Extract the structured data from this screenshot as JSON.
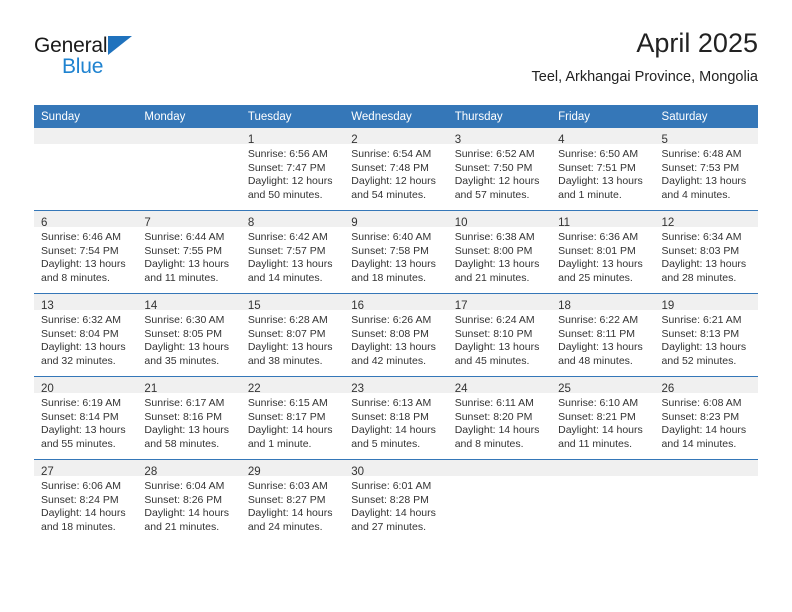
{
  "logo": {
    "primary_text": "General",
    "secondary_text": "Blue",
    "triangle_icon": "triangle-icon",
    "primary_color": "#1a1a1a",
    "secondary_color": "#1f83d0"
  },
  "header": {
    "title": "April 2025",
    "subtitle": "Teel, Arkhangai Province, Mongolia"
  },
  "colors": {
    "header_blue": "#3577b8",
    "daynum_band": "#f0f0f0",
    "text": "#333333"
  },
  "calendar": {
    "columns": [
      "Sunday",
      "Monday",
      "Tuesday",
      "Wednesday",
      "Thursday",
      "Friday",
      "Saturday"
    ],
    "weeks": [
      [
        {
          "day": "",
          "lines": []
        },
        {
          "day": "",
          "lines": []
        },
        {
          "day": "1",
          "lines": [
            "Sunrise: 6:56 AM",
            "Sunset: 7:47 PM",
            "Daylight: 12 hours",
            "and 50 minutes."
          ]
        },
        {
          "day": "2",
          "lines": [
            "Sunrise: 6:54 AM",
            "Sunset: 7:48 PM",
            "Daylight: 12 hours",
            "and 54 minutes."
          ]
        },
        {
          "day": "3",
          "lines": [
            "Sunrise: 6:52 AM",
            "Sunset: 7:50 PM",
            "Daylight: 12 hours",
            "and 57 minutes."
          ]
        },
        {
          "day": "4",
          "lines": [
            "Sunrise: 6:50 AM",
            "Sunset: 7:51 PM",
            "Daylight: 13 hours",
            "and 1 minute."
          ]
        },
        {
          "day": "5",
          "lines": [
            "Sunrise: 6:48 AM",
            "Sunset: 7:53 PM",
            "Daylight: 13 hours",
            "and 4 minutes."
          ]
        }
      ],
      [
        {
          "day": "6",
          "lines": [
            "Sunrise: 6:46 AM",
            "Sunset: 7:54 PM",
            "Daylight: 13 hours",
            "and 8 minutes."
          ]
        },
        {
          "day": "7",
          "lines": [
            "Sunrise: 6:44 AM",
            "Sunset: 7:55 PM",
            "Daylight: 13 hours",
            "and 11 minutes."
          ]
        },
        {
          "day": "8",
          "lines": [
            "Sunrise: 6:42 AM",
            "Sunset: 7:57 PM",
            "Daylight: 13 hours",
            "and 14 minutes."
          ]
        },
        {
          "day": "9",
          "lines": [
            "Sunrise: 6:40 AM",
            "Sunset: 7:58 PM",
            "Daylight: 13 hours",
            "and 18 minutes."
          ]
        },
        {
          "day": "10",
          "lines": [
            "Sunrise: 6:38 AM",
            "Sunset: 8:00 PM",
            "Daylight: 13 hours",
            "and 21 minutes."
          ]
        },
        {
          "day": "11",
          "lines": [
            "Sunrise: 6:36 AM",
            "Sunset: 8:01 PM",
            "Daylight: 13 hours",
            "and 25 minutes."
          ]
        },
        {
          "day": "12",
          "lines": [
            "Sunrise: 6:34 AM",
            "Sunset: 8:03 PM",
            "Daylight: 13 hours",
            "and 28 minutes."
          ]
        }
      ],
      [
        {
          "day": "13",
          "lines": [
            "Sunrise: 6:32 AM",
            "Sunset: 8:04 PM",
            "Daylight: 13 hours",
            "and 32 minutes."
          ]
        },
        {
          "day": "14",
          "lines": [
            "Sunrise: 6:30 AM",
            "Sunset: 8:05 PM",
            "Daylight: 13 hours",
            "and 35 minutes."
          ]
        },
        {
          "day": "15",
          "lines": [
            "Sunrise: 6:28 AM",
            "Sunset: 8:07 PM",
            "Daylight: 13 hours",
            "and 38 minutes."
          ]
        },
        {
          "day": "16",
          "lines": [
            "Sunrise: 6:26 AM",
            "Sunset: 8:08 PM",
            "Daylight: 13 hours",
            "and 42 minutes."
          ]
        },
        {
          "day": "17",
          "lines": [
            "Sunrise: 6:24 AM",
            "Sunset: 8:10 PM",
            "Daylight: 13 hours",
            "and 45 minutes."
          ]
        },
        {
          "day": "18",
          "lines": [
            "Sunrise: 6:22 AM",
            "Sunset: 8:11 PM",
            "Daylight: 13 hours",
            "and 48 minutes."
          ]
        },
        {
          "day": "19",
          "lines": [
            "Sunrise: 6:21 AM",
            "Sunset: 8:13 PM",
            "Daylight: 13 hours",
            "and 52 minutes."
          ]
        }
      ],
      [
        {
          "day": "20",
          "lines": [
            "Sunrise: 6:19 AM",
            "Sunset: 8:14 PM",
            "Daylight: 13 hours",
            "and 55 minutes."
          ]
        },
        {
          "day": "21",
          "lines": [
            "Sunrise: 6:17 AM",
            "Sunset: 8:16 PM",
            "Daylight: 13 hours",
            "and 58 minutes."
          ]
        },
        {
          "day": "22",
          "lines": [
            "Sunrise: 6:15 AM",
            "Sunset: 8:17 PM",
            "Daylight: 14 hours",
            "and 1 minute."
          ]
        },
        {
          "day": "23",
          "lines": [
            "Sunrise: 6:13 AM",
            "Sunset: 8:18 PM",
            "Daylight: 14 hours",
            "and 5 minutes."
          ]
        },
        {
          "day": "24",
          "lines": [
            "Sunrise: 6:11 AM",
            "Sunset: 8:20 PM",
            "Daylight: 14 hours",
            "and 8 minutes."
          ]
        },
        {
          "day": "25",
          "lines": [
            "Sunrise: 6:10 AM",
            "Sunset: 8:21 PM",
            "Daylight: 14 hours",
            "and 11 minutes."
          ]
        },
        {
          "day": "26",
          "lines": [
            "Sunrise: 6:08 AM",
            "Sunset: 8:23 PM",
            "Daylight: 14 hours",
            "and 14 minutes."
          ]
        }
      ],
      [
        {
          "day": "27",
          "lines": [
            "Sunrise: 6:06 AM",
            "Sunset: 8:24 PM",
            "Daylight: 14 hours",
            "and 18 minutes."
          ]
        },
        {
          "day": "28",
          "lines": [
            "Sunrise: 6:04 AM",
            "Sunset: 8:26 PM",
            "Daylight: 14 hours",
            "and 21 minutes."
          ]
        },
        {
          "day": "29",
          "lines": [
            "Sunrise: 6:03 AM",
            "Sunset: 8:27 PM",
            "Daylight: 14 hours",
            "and 24 minutes."
          ]
        },
        {
          "day": "30",
          "lines": [
            "Sunrise: 6:01 AM",
            "Sunset: 8:28 PM",
            "Daylight: 14 hours",
            "and 27 minutes."
          ]
        },
        {
          "day": "",
          "lines": []
        },
        {
          "day": "",
          "lines": []
        },
        {
          "day": "",
          "lines": []
        }
      ]
    ]
  }
}
